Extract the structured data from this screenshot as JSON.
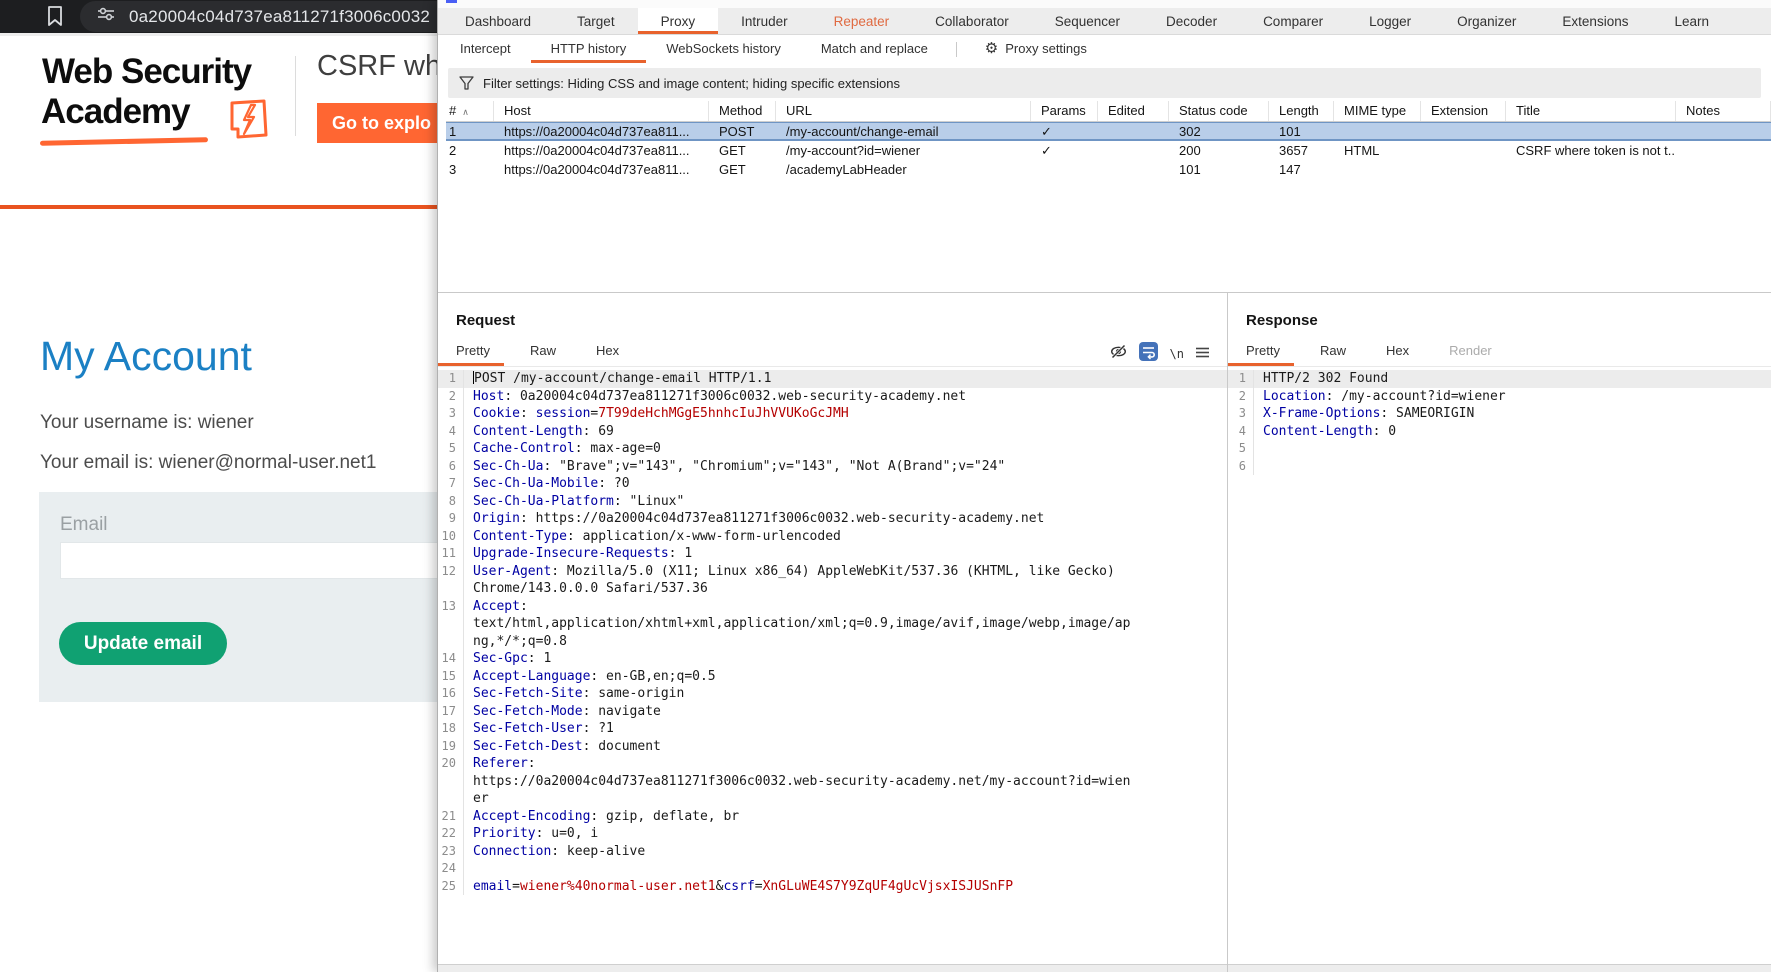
{
  "browser": {
    "url": "0a20004c04d737ea811271f3006c0032",
    "logo": {
      "line1": "Web Security",
      "line2": "Academy"
    },
    "lab_title": "CSRF wh",
    "exploit_button_label": "Go to explo",
    "account": {
      "heading": "My Account",
      "username_line": "Your username is: wiener",
      "email_line": "Your email is: wiener@normal-user.net1",
      "form": {
        "email_label": "Email",
        "email_value": "",
        "submit_label": "Update email"
      }
    }
  },
  "burp": {
    "main_tabs": [
      {
        "label": "Dashboard"
      },
      {
        "label": "Target"
      },
      {
        "label": "Proxy",
        "selected": true
      },
      {
        "label": "Intruder"
      },
      {
        "label": "Repeater",
        "accent": true
      },
      {
        "label": "Collaborator"
      },
      {
        "label": "Sequencer"
      },
      {
        "label": "Decoder"
      },
      {
        "label": "Comparer"
      },
      {
        "label": "Logger"
      },
      {
        "label": "Organizer"
      },
      {
        "label": "Extensions"
      },
      {
        "label": "Learn"
      }
    ],
    "sub_tabs": [
      {
        "label": "Intercept"
      },
      {
        "label": "HTTP history",
        "selected": true
      },
      {
        "label": "WebSockets history"
      },
      {
        "label": "Match and replace"
      }
    ],
    "proxy_settings_label": "Proxy settings",
    "filter_text": "Filter settings: Hiding CSS and image content; hiding specific extensions",
    "table": {
      "sort_icon": "∧",
      "columns": [
        "#",
        "Host",
        "Method",
        "URL",
        "Params",
        "Edited",
        "Status code",
        "Length",
        "MIME type",
        "Extension",
        "Title",
        "Notes"
      ],
      "rows": [
        {
          "selected": true,
          "cells": [
            "1",
            "https://0a20004c04d737ea811...",
            "POST",
            "/my-account/change-email",
            "✓",
            "",
            "302",
            "101",
            "",
            "",
            "",
            ""
          ]
        },
        {
          "selected": false,
          "cells": [
            "2",
            "https://0a20004c04d737ea811...",
            "GET",
            "/my-account?id=wiener",
            "✓",
            "",
            "200",
            "3657",
            "HTML",
            "",
            "CSRF where token is not t...",
            ""
          ]
        },
        {
          "selected": false,
          "cells": [
            "3",
            "https://0a20004c04d737ea811...",
            "GET",
            "/academyLabHeader",
            "",
            "",
            "101",
            "147",
            "",
            "",
            "",
            ""
          ]
        }
      ]
    },
    "request": {
      "title": "Request",
      "tabs": [
        {
          "label": "Pretty",
          "selected": true
        },
        {
          "label": "Raw"
        },
        {
          "label": "Hex"
        }
      ],
      "newline_toggle_label": "\\n",
      "lines": [
        {
          "n": "1",
          "hl": true,
          "caret": true,
          "segs": [
            [
              "t",
              "POST /my-account/change-email HTTP/1.1"
            ]
          ]
        },
        {
          "n": "2",
          "segs": [
            [
              "k",
              "Host"
            ],
            [
              "t",
              ": 0a20004c04d737ea811271f3006c0032.web-security-academy.net"
            ]
          ]
        },
        {
          "n": "3",
          "segs": [
            [
              "k",
              "Cookie"
            ],
            [
              "t",
              ": "
            ],
            [
              "k",
              "session"
            ],
            [
              "t",
              "="
            ],
            [
              "r",
              "7T99deHchMGgE5hnhcIuJhVVUKoGcJMH"
            ]
          ]
        },
        {
          "n": "4",
          "segs": [
            [
              "k",
              "Content-Length"
            ],
            [
              "t",
              ": 69"
            ]
          ]
        },
        {
          "n": "5",
          "segs": [
            [
              "k",
              "Cache-Control"
            ],
            [
              "t",
              ": max-age=0"
            ]
          ]
        },
        {
          "n": "6",
          "segs": [
            [
              "k",
              "Sec-Ch-Ua"
            ],
            [
              "t",
              ": \"Brave\";v=\"143\", \"Chromium\";v=\"143\", \"Not A(Brand\";v=\"24\""
            ]
          ]
        },
        {
          "n": "7",
          "segs": [
            [
              "k",
              "Sec-Ch-Ua-Mobile"
            ],
            [
              "t",
              ": ?0"
            ]
          ]
        },
        {
          "n": "8",
          "segs": [
            [
              "k",
              "Sec-Ch-Ua-Platform"
            ],
            [
              "t",
              ": \"Linux\""
            ]
          ]
        },
        {
          "n": "9",
          "segs": [
            [
              "k",
              "Origin"
            ],
            [
              "t",
              ": https://0a20004c04d737ea811271f3006c0032.web-security-academy.net"
            ]
          ]
        },
        {
          "n": "10",
          "segs": [
            [
              "k",
              "Content-Type"
            ],
            [
              "t",
              ": application/x-www-form-urlencoded"
            ]
          ]
        },
        {
          "n": "11",
          "segs": [
            [
              "k",
              "Upgrade-Insecure-Requests"
            ],
            [
              "t",
              ": 1"
            ]
          ]
        },
        {
          "n": "12",
          "segs": [
            [
              "k",
              "User-Agent"
            ],
            [
              "t",
              ": Mozilla/5.0 (X11; Linux x86_64) AppleWebKit/537.36 (KHTML, like Gecko)"
            ]
          ]
        },
        {
          "n": "",
          "segs": [
            [
              "t",
              "Chrome/143.0.0.0 Safari/537.36"
            ]
          ]
        },
        {
          "n": "13",
          "segs": [
            [
              "k",
              "Accept"
            ],
            [
              "t",
              ":"
            ]
          ]
        },
        {
          "n": "",
          "segs": [
            [
              "t",
              "text/html,application/xhtml+xml,application/xml;q=0.9,image/avif,image/webp,image/ap"
            ]
          ]
        },
        {
          "n": "",
          "segs": [
            [
              "t",
              "ng,*/*;q=0.8"
            ]
          ]
        },
        {
          "n": "14",
          "segs": [
            [
              "k",
              "Sec-Gpc"
            ],
            [
              "t",
              ": 1"
            ]
          ]
        },
        {
          "n": "15",
          "segs": [
            [
              "k",
              "Accept-Language"
            ],
            [
              "t",
              ": en-GB,en;q=0.5"
            ]
          ]
        },
        {
          "n": "16",
          "segs": [
            [
              "k",
              "Sec-Fetch-Site"
            ],
            [
              "t",
              ": same-origin"
            ]
          ]
        },
        {
          "n": "17",
          "segs": [
            [
              "k",
              "Sec-Fetch-Mode"
            ],
            [
              "t",
              ": navigate"
            ]
          ]
        },
        {
          "n": "18",
          "segs": [
            [
              "k",
              "Sec-Fetch-User"
            ],
            [
              "t",
              ": ?1"
            ]
          ]
        },
        {
          "n": "19",
          "segs": [
            [
              "k",
              "Sec-Fetch-Dest"
            ],
            [
              "t",
              ": document"
            ]
          ]
        },
        {
          "n": "20",
          "segs": [
            [
              "k",
              "Referer"
            ],
            [
              "t",
              ":"
            ]
          ]
        },
        {
          "n": "",
          "segs": [
            [
              "t",
              "https://0a20004c04d737ea811271f3006c0032.web-security-academy.net/my-account?id=wien"
            ]
          ]
        },
        {
          "n": "",
          "segs": [
            [
              "t",
              "er"
            ]
          ]
        },
        {
          "n": "21",
          "segs": [
            [
              "k",
              "Accept-Encoding"
            ],
            [
              "t",
              ": gzip, deflate, br"
            ]
          ]
        },
        {
          "n": "22",
          "segs": [
            [
              "k",
              "Priority"
            ],
            [
              "t",
              ": u=0, i"
            ]
          ]
        },
        {
          "n": "23",
          "segs": [
            [
              "k",
              "Connection"
            ],
            [
              "t",
              ": keep-alive"
            ]
          ]
        },
        {
          "n": "24",
          "segs": []
        },
        {
          "n": "25",
          "segs": [
            [
              "k",
              "email"
            ],
            [
              "t",
              "="
            ],
            [
              "r",
              "wiener%40normal-user.net1"
            ],
            [
              "t",
              "&"
            ],
            [
              "k",
              "csrf"
            ],
            [
              "t",
              "="
            ],
            [
              "r",
              "XnGLuWE4S7Y9ZqUF4gUcVjsxISJUSnFP"
            ]
          ]
        }
      ]
    },
    "response": {
      "title": "Response",
      "tabs": [
        {
          "label": "Pretty",
          "selected": true
        },
        {
          "label": "Raw"
        },
        {
          "label": "Hex"
        },
        {
          "label": "Render",
          "disabled": true
        }
      ],
      "lines": [
        {
          "n": "1",
          "hl": true,
          "segs": [
            [
              "t",
              "HTTP/2 302 Found"
            ]
          ]
        },
        {
          "n": "2",
          "segs": [
            [
              "k",
              "Location"
            ],
            [
              "t",
              ": /my-account?id=wiener"
            ]
          ]
        },
        {
          "n": "3",
          "segs": [
            [
              "k",
              "X-Frame-Options"
            ],
            [
              "t",
              ": SAMEORIGIN"
            ]
          ]
        },
        {
          "n": "4",
          "segs": [
            [
              "k",
              "Content-Length"
            ],
            [
              "t",
              ": 0"
            ]
          ]
        },
        {
          "n": "5",
          "segs": []
        },
        {
          "n": "6",
          "segs": []
        }
      ]
    }
  }
}
